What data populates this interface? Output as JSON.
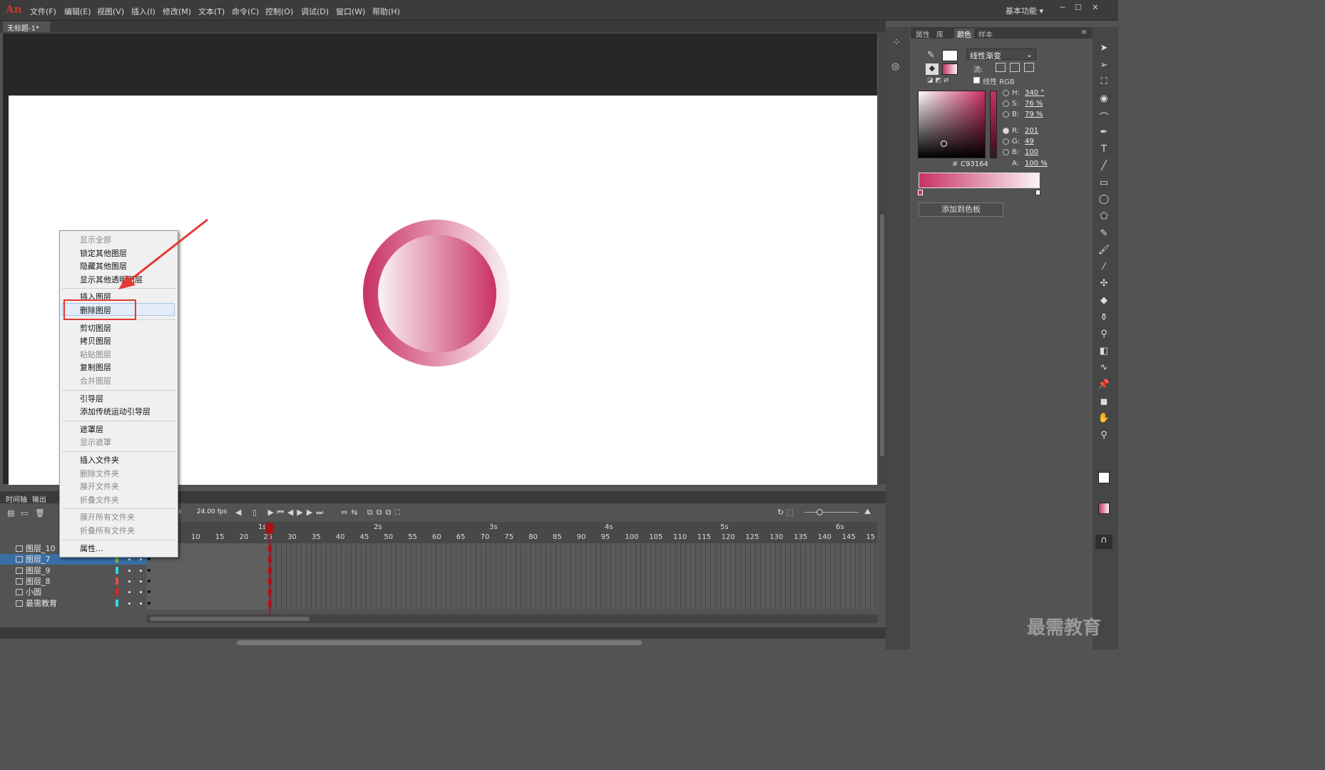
{
  "app": {
    "logo": "An",
    "workspace": "基本功能",
    "doc_tab": "无标题-1*"
  },
  "menu": [
    "文件(F)",
    "编辑(E)",
    "视图(V)",
    "插入(I)",
    "修改(M)",
    "文本(T)",
    "命令(C)",
    "控制(O)",
    "调试(D)",
    "窗口(W)",
    "帮助(H)"
  ],
  "timeline": {
    "tabs": [
      "时间轴",
      "输出"
    ],
    "fps": "24.00 fps",
    "fps_prefix": "s",
    "ruler_frames": [
      "10",
      "15",
      "20",
      "25",
      "30",
      "35",
      "40",
      "45",
      "50",
      "55",
      "60",
      "65",
      "70",
      "75",
      "80",
      "85",
      "90",
      "95",
      "100",
      "105",
      "110",
      "115",
      "120",
      "125",
      "130",
      "135",
      "140",
      "145",
      "15"
    ],
    "ruler_seconds": [
      "1s",
      "2s",
      "3s",
      "4s",
      "5s",
      "6s"
    ],
    "layers": [
      {
        "name": "图层_10",
        "color": "#ffffff"
      },
      {
        "name": "图层_7",
        "color": "#7ac142",
        "selected": true
      },
      {
        "name": "图层_9",
        "color": "#29d9e8"
      },
      {
        "name": "图层_8",
        "color": "#e84a4a"
      },
      {
        "name": "小圆",
        "color": "#e81b1b"
      },
      {
        "name": "最需教育",
        "color": "#29d9e8"
      }
    ]
  },
  "context_menu": {
    "items": [
      {
        "label": "显示全部",
        "disabled": true
      },
      {
        "label": "锁定其他图层"
      },
      {
        "label": "隐藏其他图层"
      },
      {
        "label": "显示其他透明图层"
      },
      {
        "label": "插入图层"
      },
      {
        "label": "删除图层",
        "highlight": true
      },
      {
        "label": "剪切图层"
      },
      {
        "label": "拷贝图层"
      },
      {
        "label": "粘贴图层",
        "disabled": true
      },
      {
        "label": "复制图层"
      },
      {
        "label": "合并图层",
        "disabled": true
      },
      {
        "label": "引导层"
      },
      {
        "label": "添加传统运动引导层"
      },
      {
        "label": "遮罩层"
      },
      {
        "label": "显示遮罩",
        "disabled": true
      },
      {
        "label": "插入文件夹"
      },
      {
        "label": "删除文件夹",
        "disabled": true
      },
      {
        "label": "展开文件夹",
        "disabled": true
      },
      {
        "label": "折叠文件夹",
        "disabled": true
      },
      {
        "label": "展开所有文件夹",
        "disabled": true
      },
      {
        "label": "折叠所有文件夹",
        "disabled": true
      },
      {
        "label": "属性..."
      }
    ]
  },
  "color_panel": {
    "tabs": [
      "属性",
      "库",
      "颜色",
      "样本"
    ],
    "fill_type": "线性渐变",
    "flow_label": "流:",
    "linear_rgb": "线性 RGB",
    "H": "340",
    "H_unit": "°",
    "S": "76",
    "S_unit": "%",
    "B": "79",
    "B_unit": "%",
    "R": "201",
    "G": "49",
    "Bv": "100",
    "A": "100",
    "A_unit": "%",
    "hex_prefix": "#",
    "hex": "C93164",
    "add_swatch": "添加到色板",
    "accent": "#c93164"
  },
  "watermark": "最需教育"
}
